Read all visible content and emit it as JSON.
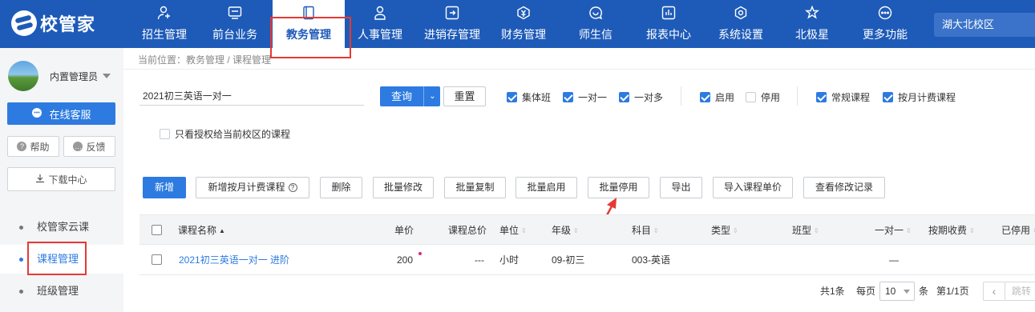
{
  "app": {
    "logo_text": "校管家"
  },
  "nav": [
    {
      "label": "招生管理",
      "icon": "person-add-icon"
    },
    {
      "label": "前台业务",
      "icon": "monitor-icon"
    },
    {
      "label": "教务管理",
      "icon": "book-icon"
    },
    {
      "label": "人事管理",
      "icon": "user-icon"
    },
    {
      "label": "进销存管理",
      "icon": "inventory-icon"
    },
    {
      "label": "财务管理",
      "icon": "money-icon"
    },
    {
      "label": "师生信",
      "icon": "message-icon"
    },
    {
      "label": "报表中心",
      "icon": "chart-icon"
    },
    {
      "label": "系统设置",
      "icon": "settings-icon"
    },
    {
      "label": "北极星",
      "icon": "star-icon"
    },
    {
      "label": "更多功能",
      "icon": "more-icon"
    }
  ],
  "campus": "湖大北校区",
  "sidebar": {
    "admin_name": "内置管理员",
    "online_service": "在线客服",
    "help": "帮助",
    "feedback": "反馈",
    "download": "下载中心",
    "links": [
      "校管家云课",
      "课程管理",
      "班级管理"
    ]
  },
  "breadcrumb": "当前位置：教务管理 / 课程管理",
  "filters": {
    "search_value": "2021初三英语一对一",
    "query": "查询",
    "reset": "重置",
    "type_options": [
      {
        "label": "集体班",
        "checked": true
      },
      {
        "label": "一对一",
        "checked": true
      },
      {
        "label": "一对多",
        "checked": true
      }
    ],
    "status_options": [
      {
        "label": "启用",
        "checked": true
      },
      {
        "label": "停用",
        "checked": false
      }
    ],
    "billing_options": [
      {
        "label": "常规课程",
        "checked": true
      },
      {
        "label": "按月计费课程",
        "checked": true
      }
    ],
    "authorized_only": {
      "label": "只看授权给当前校区的课程",
      "checked": false
    }
  },
  "actions": {
    "add": "新增",
    "add_monthly": "新增按月计费课程",
    "delete": "删除",
    "batch_edit": "批量修改",
    "batch_copy": "批量复制",
    "batch_enable": "批量启用",
    "batch_disable": "批量停用",
    "export": "导出",
    "import_price": "导入课程单价",
    "view_log": "查看修改记录"
  },
  "table": {
    "headers": [
      "课程名称",
      "单价",
      "课程总价",
      "单位",
      "年级",
      "科目",
      "类型",
      "班型",
      "一对一",
      "按期收费",
      "已停用"
    ],
    "rows": [
      {
        "name": "2021初三英语一对一 进阶",
        "price": "200",
        "total": "---",
        "unit": "小时",
        "grade": "09-初三",
        "subject": "003-英语",
        "one_on_one": "—"
      }
    ]
  },
  "pagination": {
    "total": "共1条",
    "per_page_label": "每页",
    "per_page": "10",
    "unit": "条",
    "page": "第1/1页",
    "prev": "‹",
    "jump": "跳转"
  },
  "colors": {
    "nav_bg": "#1e5bb8",
    "accent": "#2d7be0",
    "highlight": "#e53935"
  }
}
